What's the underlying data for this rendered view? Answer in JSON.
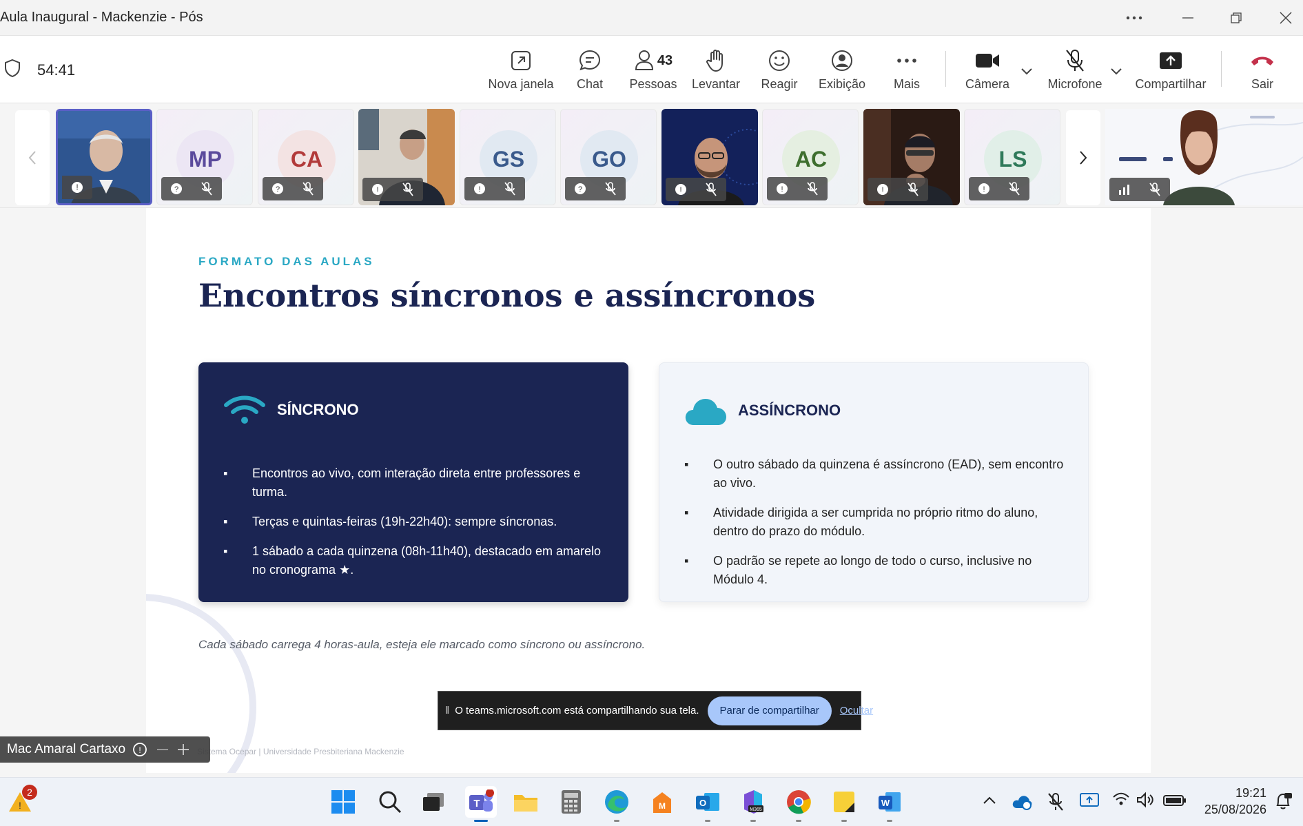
{
  "window": {
    "title": "Aula Inaugural - Mackenzie - Pós"
  },
  "meeting": {
    "timer": "54:41",
    "buttons": {
      "new_window": "Nova janela",
      "chat": "Chat",
      "people": "Pessoas",
      "people_count": "43",
      "raise": "Levantar",
      "react": "Reagir",
      "view": "Exibição",
      "more": "Mais",
      "camera": "Câmera",
      "mic": "Microfone",
      "share": "Compartilhar",
      "leave": "Sair"
    }
  },
  "participants": [
    {
      "initials": "",
      "kind": "video-selected"
    },
    {
      "initials": "MP",
      "color": "#5b4a9c",
      "bg": "#ece6f4"
    },
    {
      "initials": "CA",
      "color": "#b23a3a",
      "bg": "#f3e3e3"
    },
    {
      "initials": "",
      "kind": "video"
    },
    {
      "initials": "GS",
      "color": "#3a5a8c",
      "bg": "#e1e9f2"
    },
    {
      "initials": "GO",
      "color": "#3a5a8c",
      "bg": "#e1e9f2"
    },
    {
      "initials": "",
      "kind": "video"
    },
    {
      "initials": "AC",
      "color": "#3e6f2e",
      "bg": "#e5efe1"
    },
    {
      "initials": "",
      "kind": "video"
    },
    {
      "initials": "LS",
      "color": "#2f7a5a",
      "bg": "#e1efe8"
    }
  ],
  "slide": {
    "eyebrow": "FORMATO DAS AULAS",
    "headline": "Encontros síncronos e assíncronos",
    "sync": {
      "title": "SÍNCRONO",
      "items": [
        "Encontros ao vivo, com interação direta entre professores e turma.",
        "Terças e quintas-feiras (19h-22h40): sempre síncronas.",
        "1 sábado a cada quinzena (08h-11h40), destacado em amarelo no cronograma ★."
      ]
    },
    "async": {
      "title": "ASSÍNCRONO",
      "items": [
        "O outro sábado da quinzena é assíncrono (EAD), sem encontro ao vivo.",
        "Atividade dirigida a ser cumprida no próprio ritmo do aluno, dentro do prazo do módulo.",
        "O padrão se repete ao longo de todo o curso, inclusive no Módulo 4."
      ]
    },
    "note": "Cada sábado carrega 4 horas-aula, esteja ele marcado como síncrono ou assíncrono.",
    "footer": "Sistema Ocepar  |  Universidade Presbiteriana Mackenzie"
  },
  "share_banner": {
    "message": "O teams.microsoft.com está compartilhando sua tela.",
    "stop": "Parar de compartilhar",
    "hide": "Ocultar"
  },
  "self_view": {
    "name": "Mac Amaral Cartaxo"
  },
  "taskbar": {
    "weather_badge": "2",
    "time": "19:21",
    "date": "25/08/2026"
  },
  "colors": {
    "navy": "#1b2553",
    "accent_cyan": "#2aa8c4",
    "teams_purple": "#5b5fc7",
    "leave_red": "#c4314b"
  }
}
